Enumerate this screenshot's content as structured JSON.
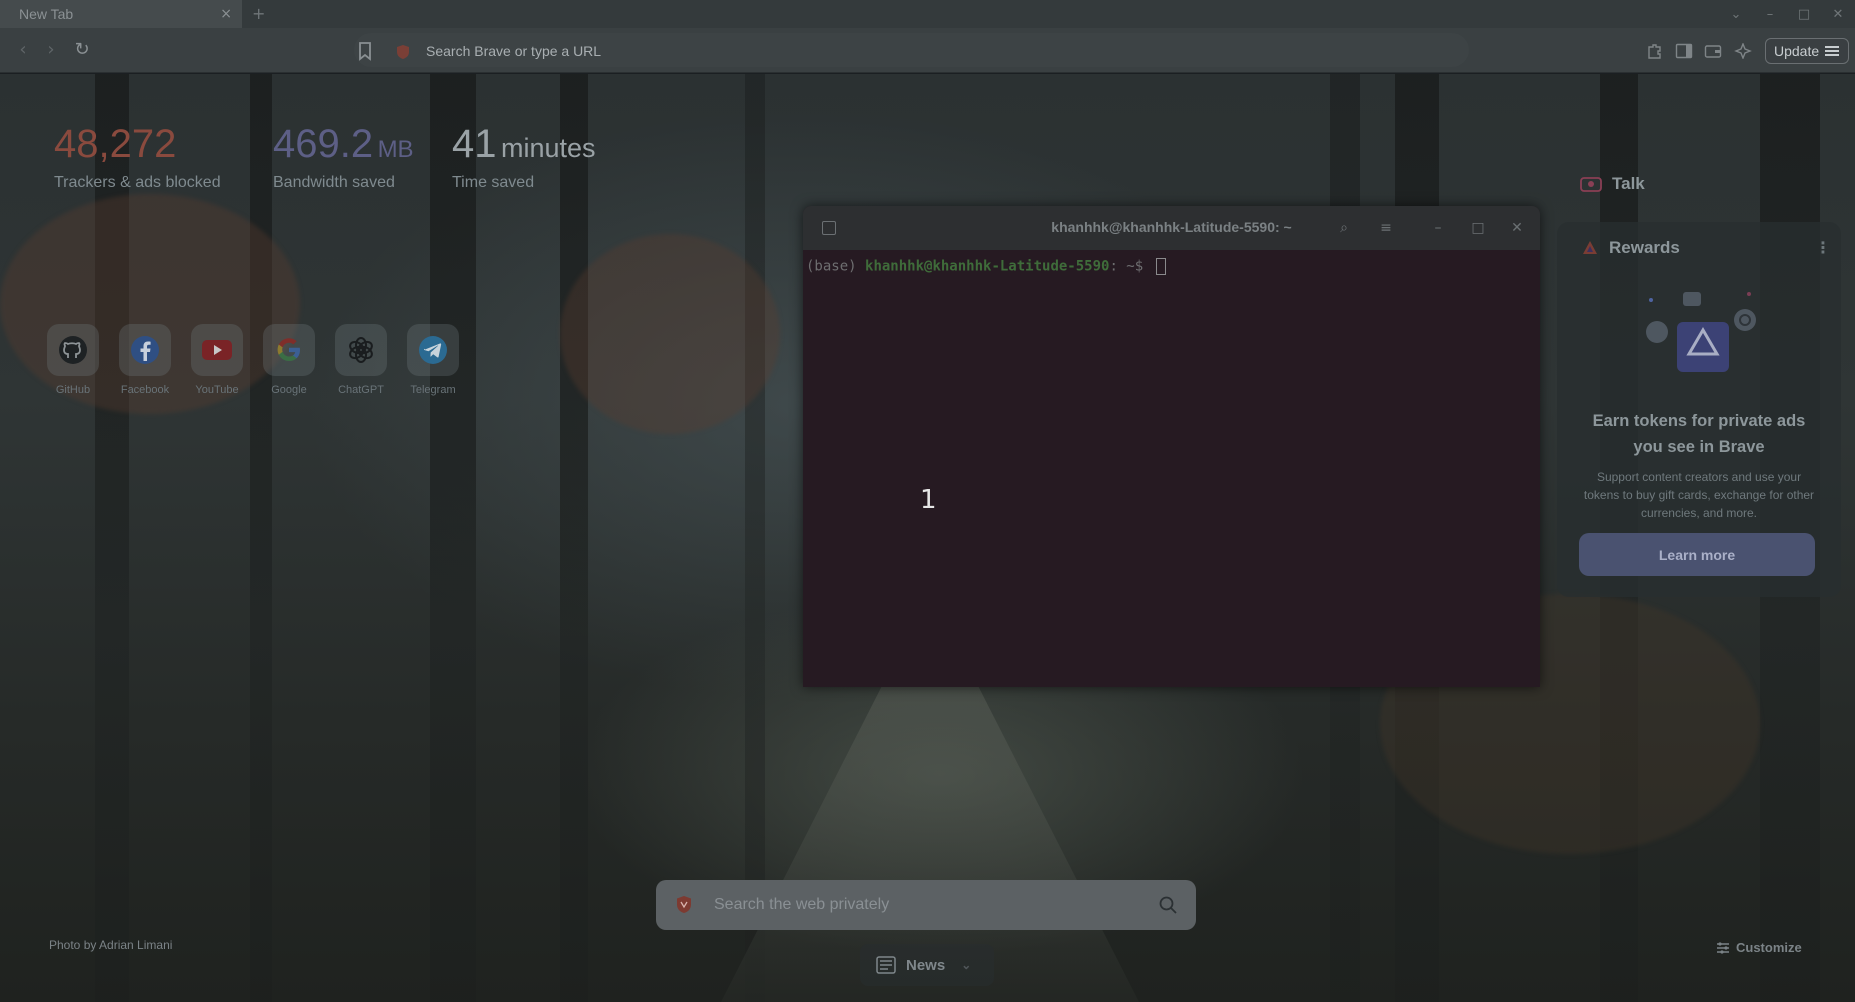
{
  "browser": {
    "tab": {
      "title": "New Tab",
      "close_glyph": "×"
    },
    "urlbar": {
      "text": "Search Brave or type a URL"
    },
    "update_label": "Update"
  },
  "stats": [
    {
      "value": "48,272",
      "unit": "",
      "label": "Trackers & ads blocked",
      "color": "#8a4a3e"
    },
    {
      "value": "469.2",
      "unit": "MB",
      "label": "Bandwidth saved",
      "color": "#5d5f86"
    },
    {
      "value": "41",
      "unit": "minutes",
      "label": "Time saved",
      "color": "#9aa2a6"
    }
  ],
  "top_sites": [
    {
      "label": "GitHub",
      "icon": "github-icon"
    },
    {
      "label": "Facebook",
      "icon": "facebook-icon"
    },
    {
      "label": "YouTube",
      "icon": "youtube-icon"
    },
    {
      "label": "Google",
      "icon": "google-icon"
    },
    {
      "label": "ChatGPT",
      "icon": "chatgpt-icon"
    },
    {
      "label": "Telegram",
      "icon": "telegram-icon"
    }
  ],
  "terminal": {
    "title": "khanhhk@khanhhk-Latitude-5590: ~",
    "prompt_env": "(base) ",
    "prompt_user": "khanhhk@khanhhk-Latitude-5590",
    "prompt_suffix": ": ~$ "
  },
  "overlay_number": "1",
  "talk": {
    "label": "Talk"
  },
  "rewards": {
    "title": "Rewards",
    "heading": "Earn tokens for private ads you see in Brave",
    "text": "Support content creators and use your tokens to buy gift cards, exchange for other currencies, and more.",
    "button": "Learn more"
  },
  "search": {
    "placeholder": "Search the web privately"
  },
  "photo_credit": "Photo by Adrian Limani",
  "news_label": "News",
  "customize_label": "Customize"
}
